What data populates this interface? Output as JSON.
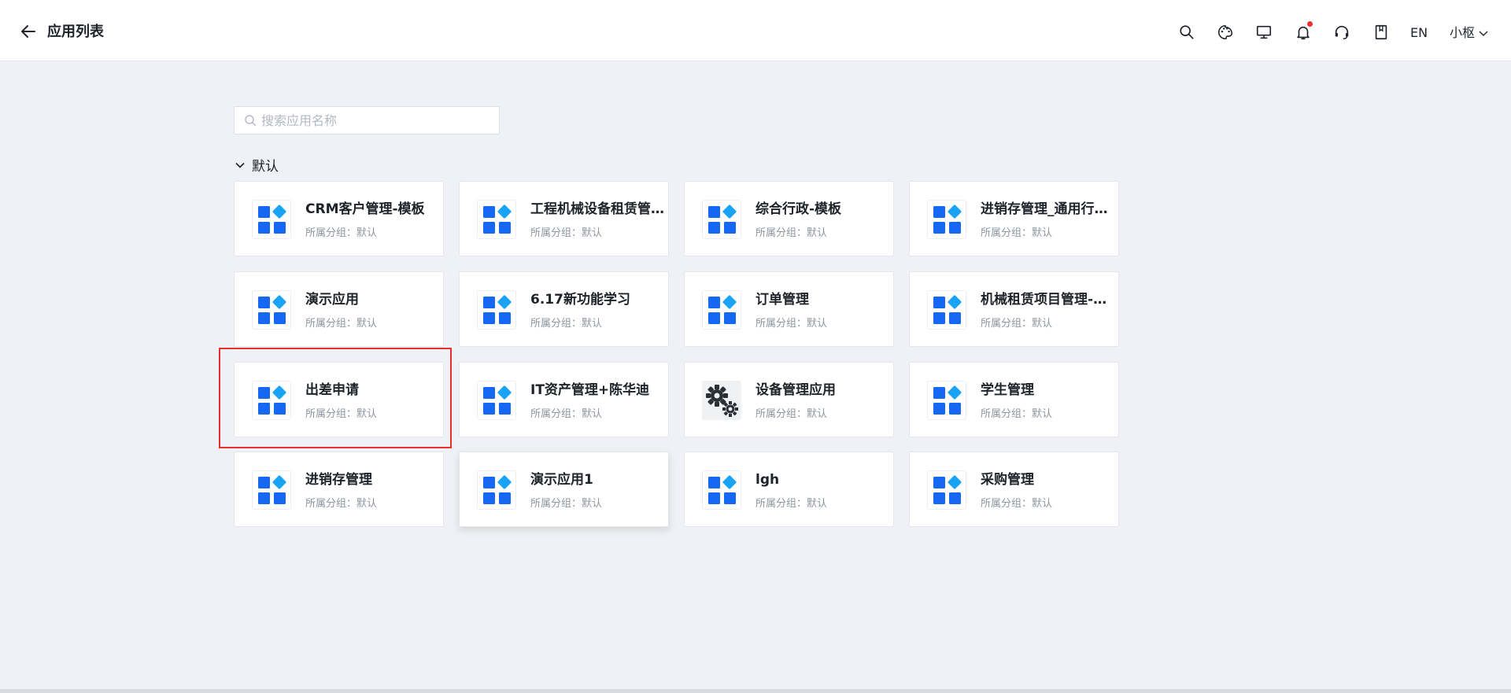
{
  "header": {
    "title": "应用列表",
    "lang": "EN",
    "user": "小枢",
    "icons": [
      "search-icon",
      "palette-icon",
      "monitor-icon",
      "bell-icon",
      "headset-icon",
      "book-icon"
    ]
  },
  "search": {
    "placeholder": "搜索应用名称",
    "value": ""
  },
  "group": {
    "title": "默认"
  },
  "apps": [
    {
      "name": "CRM客户管理-模板",
      "group": "所属分组：默认",
      "icon": "app-grid-icon"
    },
    {
      "name": "工程机械设备租赁管...",
      "group": "所属分组：默认",
      "icon": "app-grid-icon"
    },
    {
      "name": "综合行政-模板",
      "group": "所属分组：默认",
      "icon": "app-grid-icon"
    },
    {
      "name": "进销存管理_通用行业...",
      "group": "所属分组：默认",
      "icon": "app-grid-icon"
    },
    {
      "name": "演示应用",
      "group": "所属分组：默认",
      "icon": "app-grid-icon"
    },
    {
      "name": "6.17新功能学习",
      "group": "所属分组：默认",
      "icon": "app-grid-icon"
    },
    {
      "name": "订单管理",
      "group": "所属分组：默认",
      "icon": "app-grid-icon"
    },
    {
      "name": "机械租赁项目管理-模板",
      "group": "所属分组：默认",
      "icon": "app-grid-icon"
    },
    {
      "name": "出差申请",
      "group": "所属分组：默认",
      "icon": "app-grid-icon"
    },
    {
      "name": "IT资产管理+陈华迪",
      "group": "所属分组：默认",
      "icon": "app-grid-icon"
    },
    {
      "name": "设备管理应用",
      "group": "所属分组：默认",
      "icon": "gears-icon"
    },
    {
      "name": "学生管理",
      "group": "所属分组：默认",
      "icon": "app-grid-icon"
    },
    {
      "name": "进销存管理",
      "group": "所属分组：默认",
      "icon": "app-grid-icon"
    },
    {
      "name": "演示应用1",
      "group": "所属分组：默认",
      "icon": "app-grid-icon"
    },
    {
      "name": "lgh",
      "group": "所属分组：默认",
      "icon": "app-grid-icon"
    },
    {
      "name": "采购管理",
      "group": "所属分组：默认",
      "icon": "app-grid-icon"
    }
  ],
  "colors": {
    "accent": "#1667f2",
    "diamond": "#1aa3f5",
    "highlight": "#e8302e",
    "notify": "#f23030"
  }
}
